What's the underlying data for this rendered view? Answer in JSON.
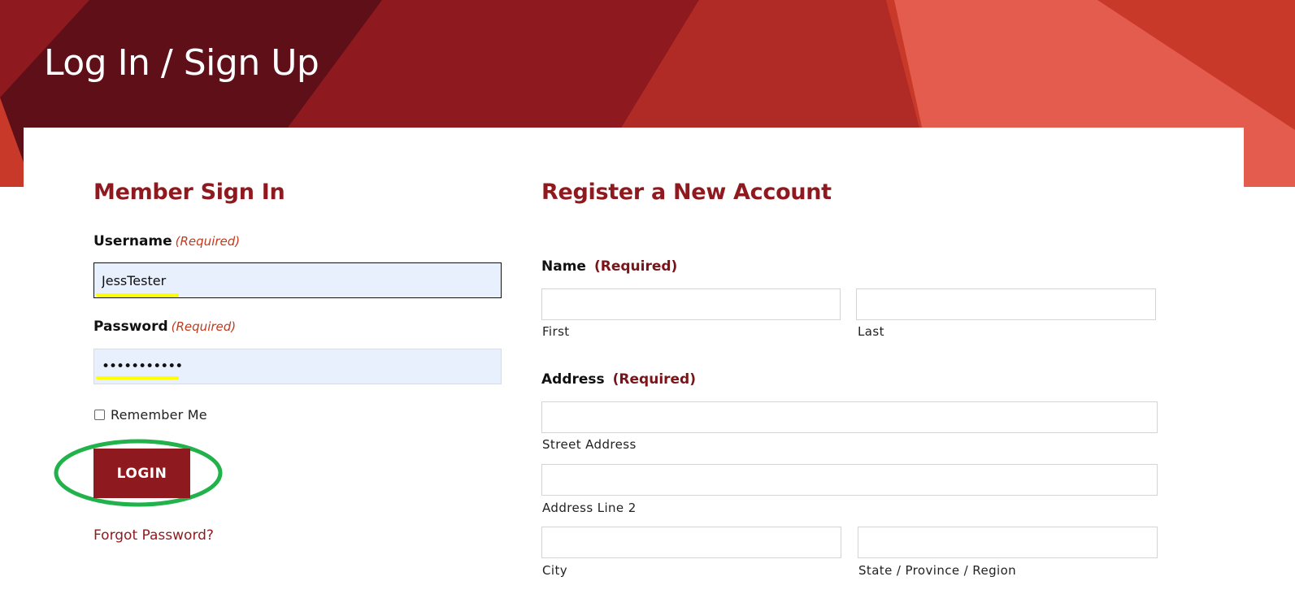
{
  "header": {
    "title": "Log In / Sign Up"
  },
  "signin": {
    "heading": "Member Sign In",
    "username": {
      "label": "Username",
      "required": "(Required)",
      "value": "JessTester"
    },
    "password": {
      "label": "Password",
      "required": "(Required)",
      "value": "•••••••••••"
    },
    "remember_label": "Remember Me",
    "remember_checked": false,
    "login_label": "LOGIN",
    "forgot_label": "Forgot Password?"
  },
  "register": {
    "heading": "Register a New Account",
    "name": {
      "label": "Name",
      "required": "(Required)",
      "first_label": "First",
      "last_label": "Last"
    },
    "address": {
      "label": "Address",
      "required": "(Required)",
      "street_label": "Street Address",
      "line2_label": "Address Line 2",
      "city_label": "City",
      "state_label": "State / Province / Region"
    }
  },
  "colors": {
    "brand": "#8e1a1f",
    "required_italic": "#c13a1e",
    "autofill_bg": "#e8f0fe",
    "highlight": "#ffff00",
    "annotation_ring": "#22b24c"
  }
}
